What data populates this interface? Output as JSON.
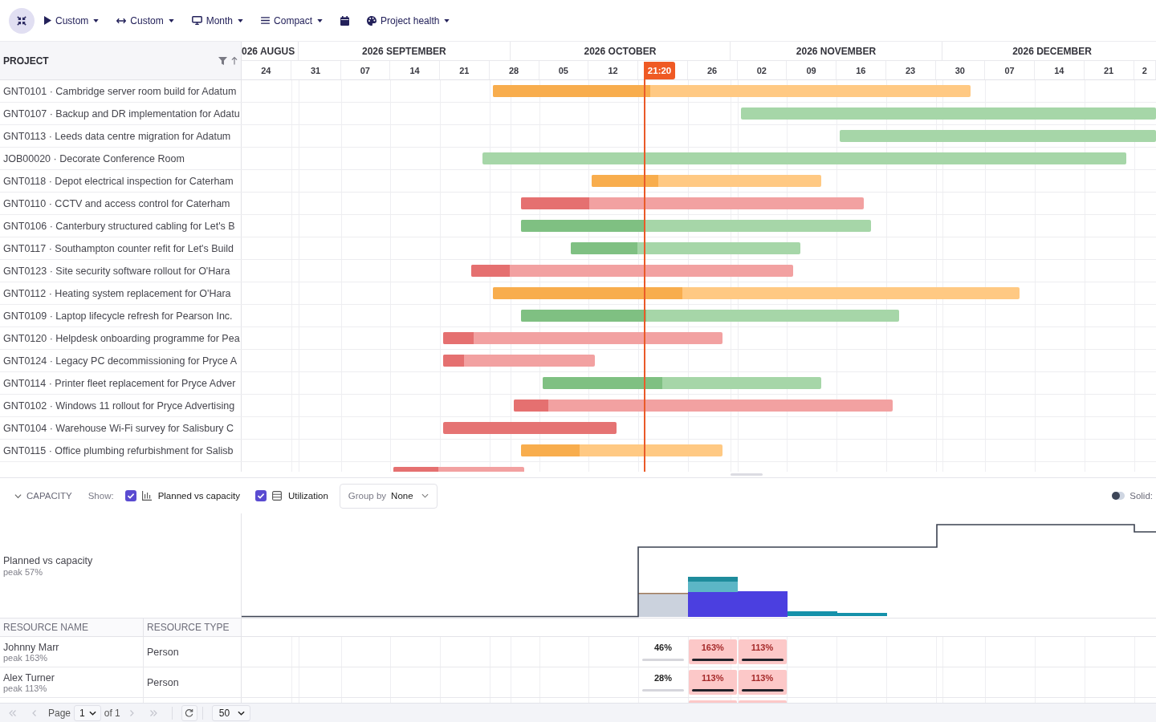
{
  "toolbar": [
    {
      "kind": "play",
      "label": "Custom",
      "dropdown": true
    },
    {
      "kind": "width",
      "label": "Custom",
      "dropdown": true
    },
    {
      "kind": "monitor",
      "label": "Month",
      "dropdown": true
    },
    {
      "kind": "list",
      "label": "Compact",
      "dropdown": true
    },
    {
      "kind": "calendar",
      "dropdown": false
    },
    {
      "kind": "palette",
      "label": "Project health",
      "dropdown": true
    }
  ],
  "gantt": {
    "column_header": "PROJECT",
    "months": [
      "026 AUGUS",
      "2026 SEPTEMBER",
      "2026 OCTOBER",
      "2026 NOVEMBER",
      "2026 DECEMBER"
    ],
    "weeks": [
      "24",
      "31",
      "07",
      "14",
      "21",
      "28",
      "05",
      "12",
      "26",
      "02",
      "09",
      "16",
      "23",
      "30",
      "07",
      "14",
      "21",
      "2"
    ],
    "now": {
      "label": "21:20"
    },
    "rows": [
      {
        "label": "GNT0101 · Cambridge server room build for Adatum",
        "color": "#ffc983",
        "level": 0.33
      },
      {
        "label": "GNT0107 · Backup and DR implementation for Adatu",
        "color": "#a6d6a8"
      },
      {
        "label": "GNT0113 · Leeds data centre migration for Adatum",
        "color": "#a6d6a8"
      },
      {
        "label": "JOB00020 · Decorate Conference Room",
        "color": "#a6d6a8"
      },
      {
        "label": "GNT0118 · Depot electrical inspection for Caterham",
        "color": "#ffc983",
        "level": 0.29
      },
      {
        "label": "GNT0110 · CCTV and access control for Caterham",
        "color": "#f2a1a1",
        "level": 0.2
      },
      {
        "label": "GNT0106 · Canterbury structured cabling for Let's B",
        "color": "#a6d6a8",
        "level": 0.35
      },
      {
        "label": "GNT0117 · Southampton counter refit for Let's Build",
        "color": "#a6d6a8",
        "level": 0.29
      },
      {
        "label": "GNT0123 · Site security software rollout for O'Hara",
        "color": "#f2a1a1",
        "level": 0.12
      },
      {
        "label": "GNT0112 · Heating system replacement for O'Hara",
        "color": "#ffc983",
        "level": 0.36
      },
      {
        "label": "GNT0109 · Laptop lifecycle refresh for Pearson Inc.",
        "color": "#a6d6a8",
        "level": 0.33
      },
      {
        "label": "GNT0120 · Helpdesk onboarding programme for Pea",
        "color": "#f2a1a1",
        "level": 0.11
      },
      {
        "label": "GNT0124 · Legacy PC decommissioning for Pryce A",
        "color": "#f2a1a1",
        "level": 0.14
      },
      {
        "label": "GNT0114 · Printer fleet replacement for Pryce Adver",
        "color": "#a6d6a8",
        "level": 0.43
      },
      {
        "label": "GNT0102 · Windows 11 rollout for Pryce Advertising",
        "color": "#f2a1a1",
        "level": 0.09
      },
      {
        "label": "GNT0104 · Warehouse Wi-Fi survey for Salisbury C",
        "color": "#e57373"
      },
      {
        "label": "GNT0115 · Office plumbing refurbishment for Salisb",
        "color": "#ffc983",
        "level": 0.29
      },
      {
        "color": "#f2a1a1",
        "level": 0.34
      }
    ]
  },
  "capacity": {
    "title": "CAPACITY",
    "expanded": true,
    "show_label": "Show:",
    "toggles": [
      {
        "kind": "chart",
        "label": "Planned vs capacity",
        "checked": true
      },
      {
        "kind": "table",
        "label": "Utilization",
        "checked": true
      }
    ],
    "group_by": {
      "label": "Group by",
      "value": "None"
    },
    "solid": {
      "label": "Solid:",
      "on": false
    },
    "chart_title": "Planned vs capacity",
    "chart_peak": "peak 57%",
    "columns": [
      "RESOURCE NAME",
      "RESOURCE TYPE"
    ],
    "resources": [
      {
        "name": "Johnny Marr",
        "peak": "peak 163%",
        "type": "Person",
        "cells": [
          {
            "value": "46%",
            "overallocated": false
          },
          {
            "value": "163%",
            "overallocated": true
          },
          {
            "value": "113%",
            "overallocated": true
          }
        ]
      },
      {
        "name": "Alex Turner",
        "peak": "peak 113%",
        "type": "Person",
        "cells": [
          {
            "value": "28%",
            "overallocated": false
          },
          {
            "value": "113%",
            "overallocated": true
          },
          {
            "value": "113%",
            "overallocated": true
          }
        ]
      },
      {
        "cells": [
          {
            "overallocated": true
          },
          {
            "overallocated": true
          }
        ]
      }
    ]
  },
  "pager": {
    "back": [
      {
        "kind": "first",
        "disabled": true
      },
      {
        "kind": "previous",
        "disabled": true
      }
    ],
    "page_label": "Page",
    "page": "1",
    "of": "of 1",
    "forward": [
      {
        "kind": "next",
        "disabled": true
      },
      {
        "kind": "last",
        "disabled": true
      }
    ],
    "page_size": "50"
  }
}
